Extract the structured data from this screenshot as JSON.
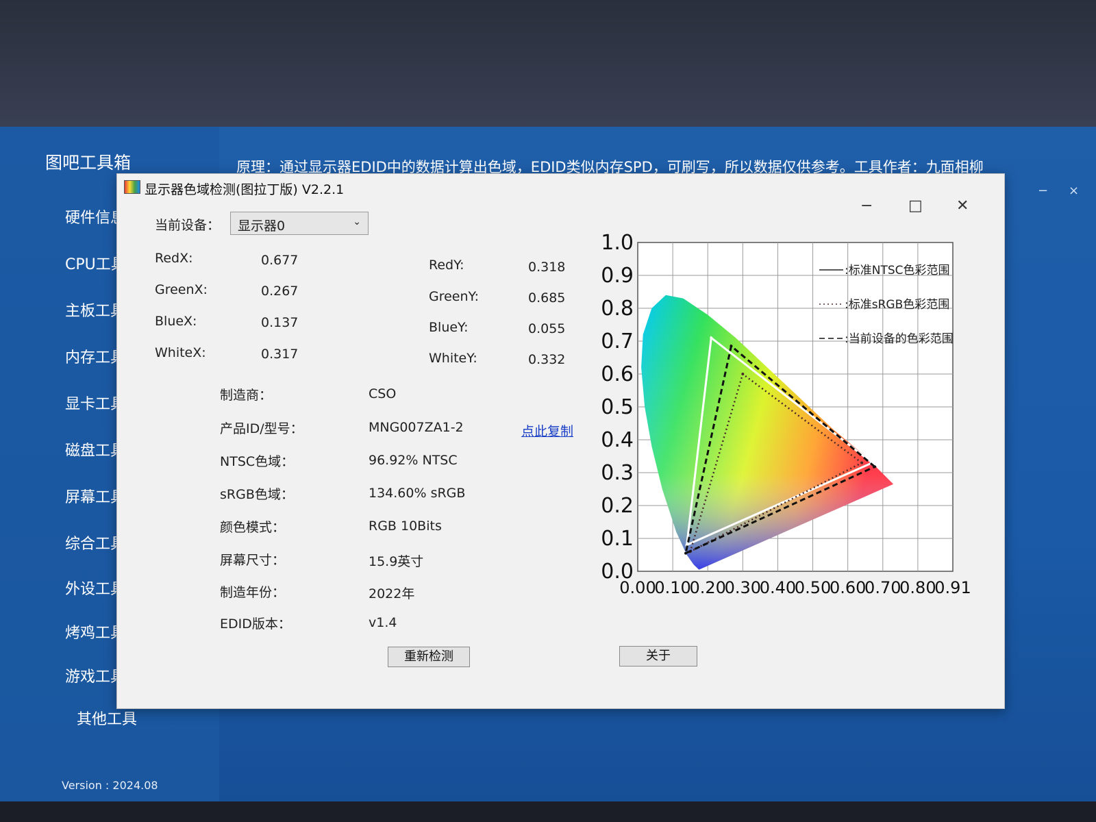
{
  "app": {
    "title": "图吧工具箱",
    "principle": "原理：通过显示器EDID中的数据计算出色域，EDID类似内存SPD，可刷写，所以数据仅供参考。工具作者：九面相柳",
    "minimize_glyph": "−",
    "close_glyph": "×",
    "version": "Version : 2024.08"
  },
  "sidebar": {
    "items": [
      {
        "label": "硬件信息"
      },
      {
        "label": "CPU工具"
      },
      {
        "label": "主板工具"
      },
      {
        "label": "内存工具"
      },
      {
        "label": "显卡工具"
      },
      {
        "label": "磁盘工具"
      },
      {
        "label": "屏幕工具"
      },
      {
        "label": "综合工具"
      },
      {
        "label": "外设工具"
      },
      {
        "label": "烤鸡工具"
      },
      {
        "label": "游戏工具"
      },
      {
        "label": "其他工具"
      }
    ]
  },
  "dialog": {
    "title": "显示器色域检测(图拉丁版) V2.2.1",
    "minimize_glyph": "−",
    "maximize_glyph": "□",
    "close_glyph": "✕",
    "device_label": "当前设备：",
    "device_value": "显示器0",
    "coords": {
      "red_x_label": "RedX:",
      "red_x": "0.677",
      "green_x_label": "GreenX:",
      "green_x": "0.267",
      "blue_x_label": "BlueX:",
      "blue_x": "0.137",
      "white_x_label": "WhiteX:",
      "white_x": "0.317",
      "red_y_label": "RedY:",
      "red_y": "0.318",
      "green_y_label": "GreenY:",
      "green_y": "0.685",
      "blue_y_label": "BlueY:",
      "blue_y": "0.055",
      "white_y_label": "WhiteY:",
      "white_y": "0.332"
    },
    "info": [
      {
        "label": "制造商：",
        "value": "CSO"
      },
      {
        "label": "产品ID/型号：",
        "value": "MNG007ZA1-2"
      },
      {
        "label": "NTSC色域：",
        "value": "96.92% NTSC"
      },
      {
        "label": "sRGB色域：",
        "value": "134.60% sRGB"
      },
      {
        "label": "颜色模式：",
        "value": "RGB 10Bits"
      },
      {
        "label": "屏幕尺寸：",
        "value": "15.9英寸"
      },
      {
        "label": "制造年份：",
        "value": "2022年"
      },
      {
        "label": "EDID版本：",
        "value": "v1.4"
      }
    ],
    "copy_link": "点此复制",
    "recheck_button": "重新检测",
    "about_button": "关于"
  },
  "chart_data": {
    "type": "scatter",
    "title": "",
    "xlabel": "",
    "ylabel": "",
    "xlim": [
      0,
      0.9
    ],
    "ylim": [
      0,
      1.0
    ],
    "x_tick_labels": [
      "0.00",
      "0.10",
      "0.20",
      "0.30",
      "0.40",
      "0.50",
      "0.60",
      "0.70",
      "0.80",
      "0.91"
    ],
    "y_tick_labels": [
      "0.0",
      "0.1",
      "0.2",
      "0.3",
      "0.4",
      "0.5",
      "0.6",
      "0.7",
      "0.8",
      "0.9",
      "1.0"
    ],
    "grid": true,
    "legend_position": "top-right",
    "series": [
      {
        "name": "标准NTSC色彩范围",
        "points": [
          [
            0.67,
            0.33
          ],
          [
            0.21,
            0.71
          ],
          [
            0.14,
            0.08
          ]
        ]
      },
      {
        "name": "标准sRGB色彩范围",
        "points": [
          [
            0.64,
            0.33
          ],
          [
            0.3,
            0.6
          ],
          [
            0.15,
            0.06
          ]
        ]
      },
      {
        "name": "当前设备的色彩范围",
        "points": [
          [
            0.677,
            0.318
          ],
          [
            0.267,
            0.685
          ],
          [
            0.137,
            0.055
          ]
        ]
      }
    ]
  }
}
